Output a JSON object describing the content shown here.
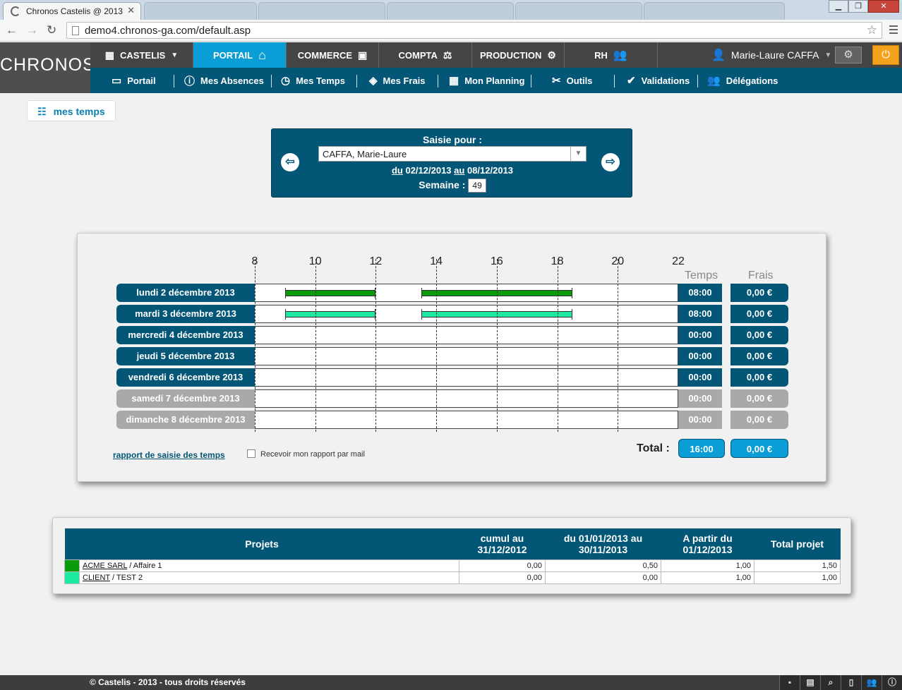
{
  "browser": {
    "tab_title": "Chronos Castelis @ 2013",
    "url": "demo4.chronos-ga.com/default.asp"
  },
  "app": {
    "logo": "CHRONOS",
    "topnav": [
      {
        "label": "CASTELIS",
        "icon": "calendar-icon"
      },
      {
        "label": "PORTAIL",
        "icon": "home-icon",
        "active": true
      },
      {
        "label": "COMMERCE",
        "icon": "contact-card-icon"
      },
      {
        "label": "COMPTA",
        "icon": "balance-icon"
      },
      {
        "label": "PRODUCTION",
        "icon": "gears-icon"
      },
      {
        "label": "RH",
        "icon": "users-icon"
      }
    ],
    "user_name": "Marie-Laure CAFFA",
    "subnav": [
      {
        "label": "Portail",
        "icon": "window-icon"
      },
      {
        "label": "Mes Absences",
        "icon": "info-icon"
      },
      {
        "label": "Mes Temps",
        "icon": "clock-icon"
      },
      {
        "label": "Mes Frais",
        "icon": "tag-icon"
      },
      {
        "label": "Mon Planning",
        "icon": "calendar-icon"
      },
      {
        "label": "Outils",
        "icon": "tools-icon"
      },
      {
        "label": "Validations",
        "icon": "check-icon"
      },
      {
        "label": "Délégations",
        "icon": "users-icon"
      }
    ]
  },
  "page": {
    "title": "mes temps"
  },
  "selector": {
    "label": "Saisie pour :",
    "person": "CAFFA, Marie-Laure",
    "du": "du",
    "date_from": "02/12/2013",
    "au": "au",
    "date_to": "08/12/2013",
    "week_label": "Semaine :",
    "week": "49"
  },
  "timesheet": {
    "hours": [
      "8",
      "10",
      "12",
      "14",
      "16",
      "18",
      "20",
      "22"
    ],
    "hour_range": [
      8,
      22
    ],
    "col_temps": "Temps",
    "col_frais": "Frais",
    "days": [
      {
        "label": "lundi 2 décembre 2013",
        "temps": "08:00",
        "frais": "0,00 €",
        "weekend": false,
        "bars": [
          {
            "start": 9,
            "end": 12,
            "project": 0
          },
          {
            "start": 13.5,
            "end": 18.5,
            "project": 0
          }
        ]
      },
      {
        "label": "mardi 3 décembre 2013",
        "temps": "08:00",
        "frais": "0,00 €",
        "weekend": false,
        "bars": [
          {
            "start": 9,
            "end": 12,
            "project": 1
          },
          {
            "start": 13.5,
            "end": 18.5,
            "project": 1
          }
        ]
      },
      {
        "label": "mercredi 4 décembre 2013",
        "temps": "00:00",
        "frais": "0,00 €",
        "weekend": false,
        "bars": []
      },
      {
        "label": "jeudi 5 décembre 2013",
        "temps": "00:00",
        "frais": "0,00 €",
        "weekend": false,
        "bars": []
      },
      {
        "label": "vendredi 6 décembre 2013",
        "temps": "00:00",
        "frais": "0,00 €",
        "weekend": false,
        "bars": []
      },
      {
        "label": "samedi 7 décembre 2013",
        "temps": "00:00",
        "frais": "0,00 €",
        "weekend": true,
        "bars": []
      },
      {
        "label": "dimanche 8 décembre 2013",
        "temps": "00:00",
        "frais": "0,00 €",
        "weekend": true,
        "bars": []
      }
    ],
    "total_label": "Total :",
    "total_temps": "16:00",
    "total_frais": "0,00 €",
    "report_link": "rapport de saisie des temps",
    "mail_label": "Recevoir mon rapport par mail"
  },
  "projects": {
    "headers": [
      "Projets",
      "cumul au 31/12/2012",
      "du 01/01/2013 au 30/11/2013",
      "A partir du 01/12/2013",
      "Total projet"
    ],
    "rows": [
      {
        "color": "#0a9b0a",
        "client": "ACME SARL",
        "affaire": " / Affaire 1",
        "cumul": "0,00",
        "periode": "0,50",
        "apartir": "1,00",
        "total": "1,50"
      },
      {
        "color": "#1de9a0",
        "client": "CLIENT",
        "affaire": " / TEST 2",
        "cumul": "0,00",
        "periode": "0,00",
        "apartir": "1,00",
        "total": "1,00"
      }
    ]
  },
  "footer": {
    "copyright": "© Castelis - 2013 - tous droits réservés"
  }
}
